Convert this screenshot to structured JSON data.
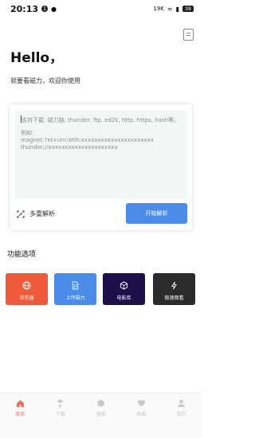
{
  "status_bar": {
    "time": "20:13",
    "notif_badge": "1",
    "network_speed": "19K",
    "battery": "39"
  },
  "header": {
    "title": "Hello，",
    "subtitle": "就要看磁力，欢迎你使用"
  },
  "input_card": {
    "placeholder_lines": [
      "支持下载: 磁力链, thunder, ftp, ed2k, http, https, hash等。",
      "",
      "例如：",
      "magnet:?xt=urn:btih:xxxxxxxxxxxxxxxxxxxxxx",
      "thunder://xxxxxxxxxxxxxxxxxxxxx"
    ],
    "multi_parse_label": "多重解析",
    "start_button_label": "开始解析"
  },
  "functions": {
    "section_title": "功能选项",
    "tiles": [
      {
        "label": "浏览器",
        "icon": "globe-icon",
        "color": "#ef5a3c"
      },
      {
        "label": "上传磁力",
        "icon": "document-icon",
        "color": "#4a8ce8"
      },
      {
        "label": "电影库",
        "icon": "cube-icon",
        "color": "#1c0f4a"
      },
      {
        "label": "极速观看",
        "icon": "lightning-icon",
        "color": "#2b2b2b"
      }
    ]
  },
  "bottom_nav": {
    "items": [
      {
        "label": "首页",
        "icon": "home-icon",
        "active": true
      },
      {
        "label": "下载",
        "icon": "download-icon",
        "active": false
      },
      {
        "label": "搜索",
        "icon": "search-icon",
        "active": false
      },
      {
        "label": "收藏",
        "icon": "heart-icon",
        "active": false
      },
      {
        "label": "我的",
        "icon": "user-icon",
        "active": false
      }
    ],
    "active_color": "#ec6d5a",
    "inactive_color": "#c8c8c8"
  }
}
